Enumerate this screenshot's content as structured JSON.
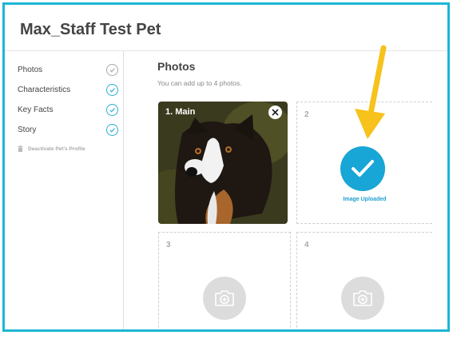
{
  "page": {
    "title": "Max_Staff Test Pet"
  },
  "sidebar": {
    "items": [
      {
        "label": "Photos",
        "status": "incomplete"
      },
      {
        "label": "Characteristics",
        "status": "complete"
      },
      {
        "label": "Key Facts",
        "status": "complete"
      },
      {
        "label": "Story",
        "status": "complete"
      }
    ],
    "deactivate_label": "Deactivate Pet's Profile"
  },
  "main": {
    "title": "Photos",
    "subtitle": "You can add up to 4 photos.",
    "slots": [
      {
        "number": "1",
        "label": "1. Main",
        "state": "photo"
      },
      {
        "number": "2",
        "state": "uploaded",
        "status_text": "Image Uploaded"
      },
      {
        "number": "3",
        "state": "empty"
      },
      {
        "number": "4",
        "state": "empty"
      }
    ]
  },
  "colors": {
    "accent": "#1cb6d6",
    "check_blue": "#17a6d6",
    "annotation_arrow": "#f6c21b"
  },
  "icons": [
    "check-icon",
    "trash-icon",
    "close-icon",
    "camera-icon",
    "arrow-annotation"
  ]
}
